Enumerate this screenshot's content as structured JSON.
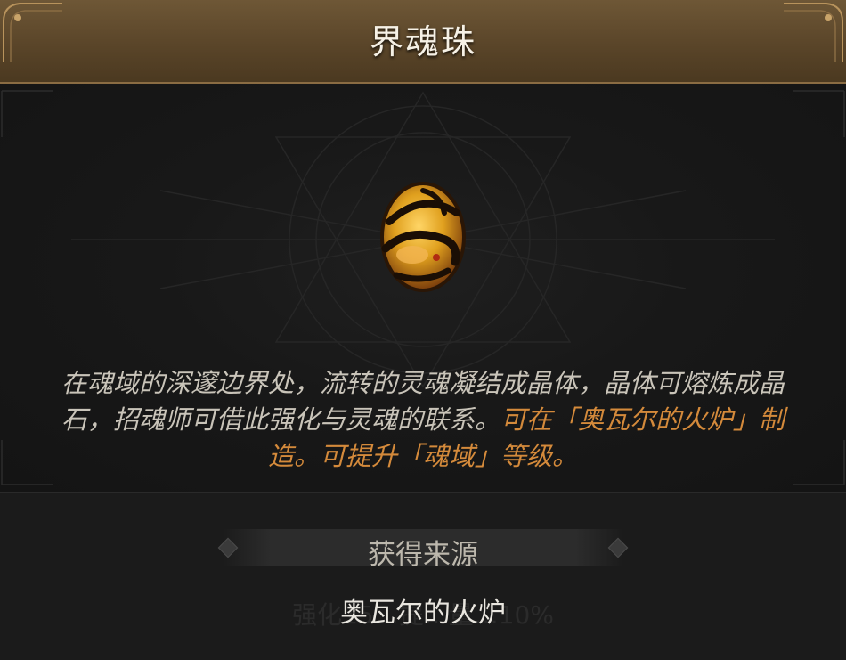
{
  "header": {
    "title": "界魂珠"
  },
  "item": {
    "icon": "soul-orb-icon",
    "description": {
      "plain": "在魂域的深邃边界处，流转的灵魂凝结成晶体，晶体可熔炼成晶石，招魂师可借此强化与灵魂的联系。",
      "highlight": "可在「奥瓦尔的火炉」制造。可提升「魂域」等级。"
    }
  },
  "source": {
    "title": "获得来源",
    "ghost_text": "强化15…提…量…10%",
    "items": [
      "奥瓦尔的火炉"
    ]
  },
  "colors": {
    "header": "#5a4529",
    "highlight": "#d48a3b",
    "text": "#c9c4b9",
    "gem": "#e0a01e"
  }
}
